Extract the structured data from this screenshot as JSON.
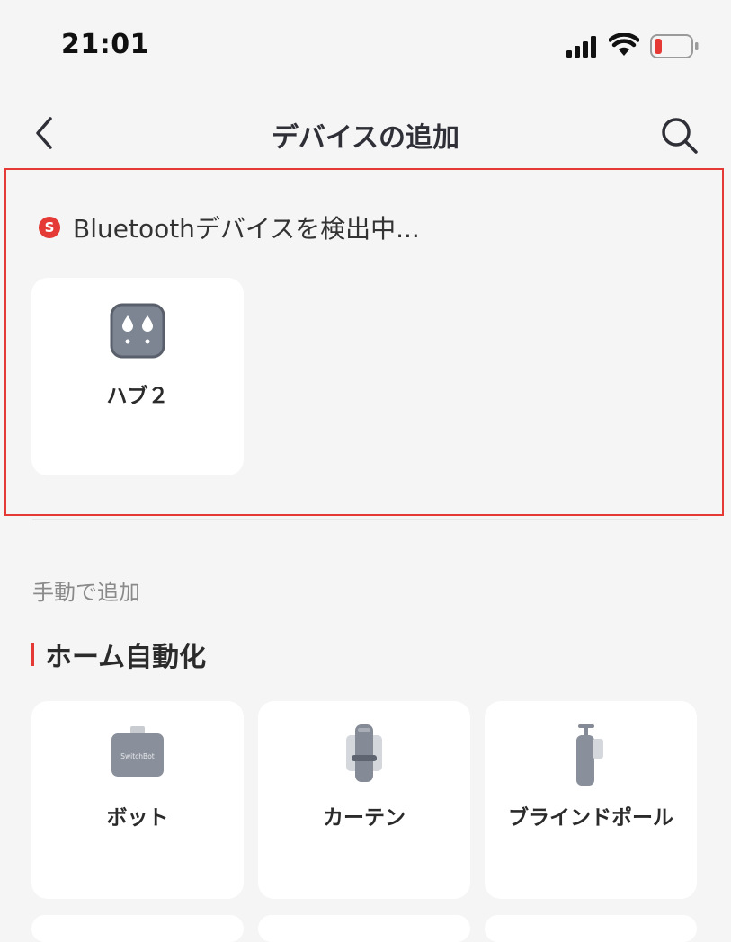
{
  "status_bar": {
    "time": "21:01",
    "icons": [
      "signal-icon",
      "wifi-icon",
      "battery-icon"
    ],
    "battery_color": "#e53935"
  },
  "nav": {
    "title": "デバイスの追加",
    "back_icon": "back-icon",
    "search_icon": "search-icon"
  },
  "bluetooth": {
    "badge": "S",
    "text": "Bluetoothデバイスを検出中...",
    "devices": [
      {
        "label": "ハブ２",
        "icon": "hub2-icon"
      }
    ]
  },
  "manual": {
    "label": "手動で追加"
  },
  "category": {
    "title": "ホーム自動化",
    "accent": "#e53935",
    "items": [
      {
        "label": "ボット",
        "icon": "bot-icon",
        "icon_text": "SwitchBot"
      },
      {
        "label": "カーテン",
        "icon": "curtain-icon"
      },
      {
        "label": "ブラインドポール",
        "icon": "blind-tilt-icon"
      }
    ]
  }
}
